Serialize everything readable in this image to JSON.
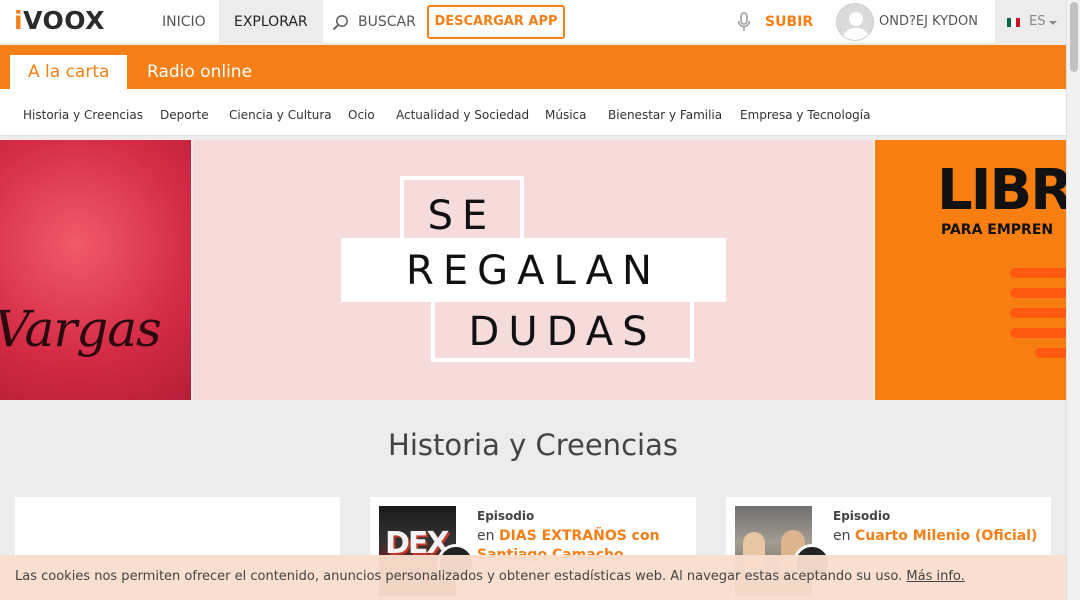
{
  "header": {
    "logo_text": "ivoox",
    "logo_i": "i",
    "logo_rest": "VOOX",
    "nav": {
      "inicio": "INICIO",
      "explorar": "EXPLORAR",
      "buscar": "BUSCAR"
    },
    "download_label": "DESCARGAR APP",
    "upload_label": "SUBIR",
    "user_name": "OND?EJ KYDON",
    "language": "ES"
  },
  "tabs": {
    "a_la_carta": "A la carta",
    "radio_online": "Radio online"
  },
  "categories": [
    "Historia y Creencias",
    "Deporte",
    "Ciencia y Cultura",
    "Ocio",
    "Actualidad y Sociedad",
    "Música",
    "Bienestar y Familia",
    "Empresa y Tecnología"
  ],
  "carousel": {
    "left_text": "Vargas",
    "center": {
      "line1": "SE",
      "line2": "REGALAN",
      "line3": "DUDAS"
    },
    "right": {
      "big": "LIBR",
      "small": "PARA EMPREN"
    }
  },
  "section": {
    "title": "Historia y Creencias"
  },
  "cards": [
    {},
    {
      "type": "Episodio",
      "prefix": "en",
      "podcast_line1": "DIAS EXTRAÑOS con",
      "podcast_line2": "Santiago Camacho",
      "thumb_text": "DEX"
    },
    {
      "type": "Episodio",
      "prefix": "en",
      "podcast_line1": "Cuarto Milenio (Oficial)"
    }
  ],
  "cookie": {
    "text": "Las cookies nos permiten ofrecer el contenido, anuncios personalizados y obtener estadísticas web. Al navegar estas aceptando su uso.",
    "link": "Más info."
  },
  "colors": {
    "brand_orange": "#f57f17",
    "flag": [
      "#006847",
      "#ffffff",
      "#ce1126"
    ]
  }
}
